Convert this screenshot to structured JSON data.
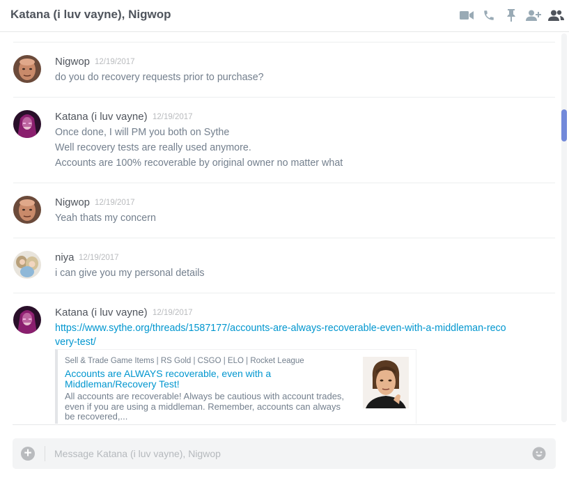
{
  "header": {
    "title": "Katana (i luv vayne), Nigwop",
    "icons": [
      "video-call-icon",
      "voice-call-icon",
      "pin-icon",
      "add-friend-icon",
      "members-icon"
    ]
  },
  "messages": [
    {
      "username": "Nigwop",
      "timestamp": "12/19/2017",
      "lines": [
        "do you do recovery requests prior to purchase?"
      ]
    },
    {
      "username": "Katana (i luv vayne)",
      "timestamp": "12/19/2017",
      "lines": [
        "Once done, I will PM you both on Sythe",
        "Well recovery tests are really used anymore.",
        "Accounts are 100% recoverable by original owner no matter what"
      ]
    },
    {
      "username": "Nigwop",
      "timestamp": "12/19/2017",
      "lines": [
        "Yeah thats my concern"
      ]
    },
    {
      "username": "niya",
      "timestamp": "12/19/2017",
      "lines": [
        "i can give you my personal details"
      ]
    },
    {
      "username": "Katana (i luv vayne)",
      "timestamp": "12/19/2017",
      "link": "https://www.sythe.org/threads/1587177/accounts-are-always-recoverable-even-with-a-middleman-recovery-test/",
      "embed": {
        "provider": "Sell & Trade Game Items | RS Gold | CSGO | ELO | Rocket League",
        "title": "Accounts are ALWAYS recoverable, even with a Middleman/Recovery Test!",
        "description": "All accounts are recoverable! Always be cautious with account trades, even if you are using a middleman. Remember, accounts can always be recovered,..."
      }
    }
  ],
  "composer": {
    "placeholder": "Message Katana (i luv vayne), Nigwop",
    "value": ""
  },
  "colors": {
    "link": "#0096cf",
    "username": "#4f545c",
    "text": "#737f8d",
    "timestamp": "#b9bbbe",
    "scrollbar": "#7289da"
  }
}
